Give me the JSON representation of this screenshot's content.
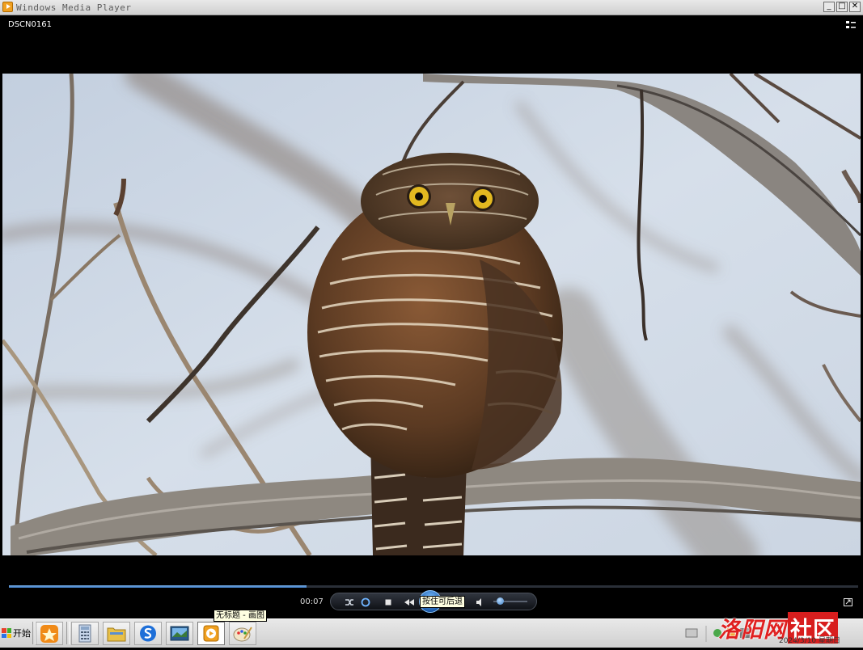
{
  "window": {
    "title": "Windows Media Player",
    "minimize_label": "_",
    "maximize_label": "□",
    "close_label": "✕"
  },
  "media": {
    "title": "DSCN0161"
  },
  "controls": {
    "elapsed": "00:07",
    "progress_fraction": 0.35,
    "volume_fraction": 0.2,
    "tooltip": "按住可后退"
  },
  "taskbar": {
    "start_label": "开始",
    "tooltip": "无标题 - 画图",
    "items": [
      "star-app",
      "calculator",
      "folder",
      "sogou",
      "screenshot",
      "media-player",
      "paint"
    ],
    "clock": "2024/3/10 星期日"
  },
  "watermark": {
    "text": "洛阳网",
    "box_text": "社区"
  },
  "colors": {
    "accent": "#3c78c0",
    "watermark_red": "#d81e1e"
  }
}
